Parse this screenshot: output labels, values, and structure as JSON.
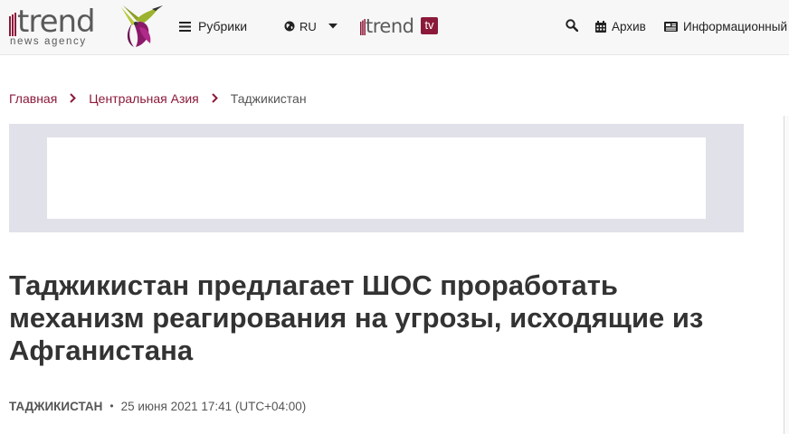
{
  "header": {
    "logo_text": "trend",
    "logo_subtitle": "news agency",
    "nav_rubriki_label": "Рубрики",
    "language_label": "RU",
    "tv_logo_text": "trend",
    "tv_badge": "tv",
    "archive_label": "Архив",
    "info_label": "Информационный",
    "icons": {
      "menu": "hamburger-icon",
      "globe": "globe-icon",
      "caret": "caret-down-icon",
      "search": "search-icon",
      "calendar": "calendar-icon",
      "newspaper": "newspaper-icon"
    }
  },
  "breadcrumb": {
    "items": [
      "Главная",
      "Центральная Азия"
    ],
    "current": "Таджикистан"
  },
  "article": {
    "title": "Таджикистан предлагает ШОС проработать механизм реагирования на угрозы, исходящие из Афганистана",
    "category": "ТАДЖИКИСТАН",
    "date": "25 июня 2021 17:41 (UTC+04:00)"
  },
  "colors": {
    "brand": "#8b1a3a",
    "header_bg": "#f7f7f7",
    "ad_bg": "#e1e1e9",
    "text": "#333333"
  }
}
